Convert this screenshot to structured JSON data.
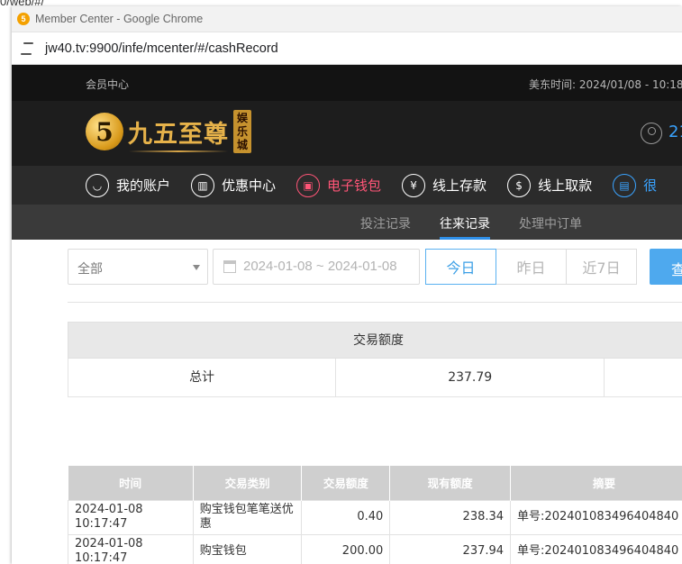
{
  "background_url_fragment": "0/web/#/",
  "window": {
    "title": "Member Center - Google Chrome",
    "url": "jw40.tv:9900/infe/mcenter/#/cashRecord"
  },
  "topbar": {
    "left": "会员中心",
    "time_label": "美东时间: 2024/01/08 - 10:18"
  },
  "header": {
    "logo_mark": "5",
    "brand": "九五至尊",
    "brand_tag": "娱乐城",
    "user_id_partial": "21"
  },
  "nav": [
    {
      "label": "我的账户",
      "icon": "user-icon"
    },
    {
      "label": "优惠中心",
      "icon": "gift-icon"
    },
    {
      "label": "电子钱包",
      "icon": "wallet-icon",
      "active": true
    },
    {
      "label": "线上存款",
      "icon": "deposit-icon"
    },
    {
      "label": "线上取款",
      "icon": "withdraw-icon"
    },
    {
      "label": "很",
      "icon": "document-icon"
    }
  ],
  "subnav": [
    "投注记录",
    "往来记录",
    "处理中订单"
  ],
  "filters": {
    "type_select": "全部",
    "date_range": "2024-01-08 ~ 2024-01-08",
    "day_buttons": [
      "今日",
      "昨日",
      "近7日"
    ],
    "query_button": "查"
  },
  "summary": {
    "header": "交易额度",
    "label": "总计",
    "value": "237.79"
  },
  "records": {
    "columns": [
      "时间",
      "交易类别",
      "交易额度",
      "现有额度",
      "摘要"
    ],
    "rows": [
      {
        "time": "2024-01-08 10:17:47",
        "type": "购宝钱包笔笔送优惠",
        "amount": "0.40",
        "balance": "238.34",
        "summary": "单号:202401083496404840"
      },
      {
        "time": "2024-01-08 10:17:47",
        "type": "购宝钱包",
        "amount": "200.00",
        "balance": "237.94",
        "summary": "单号:202401083496404840"
      }
    ]
  }
}
